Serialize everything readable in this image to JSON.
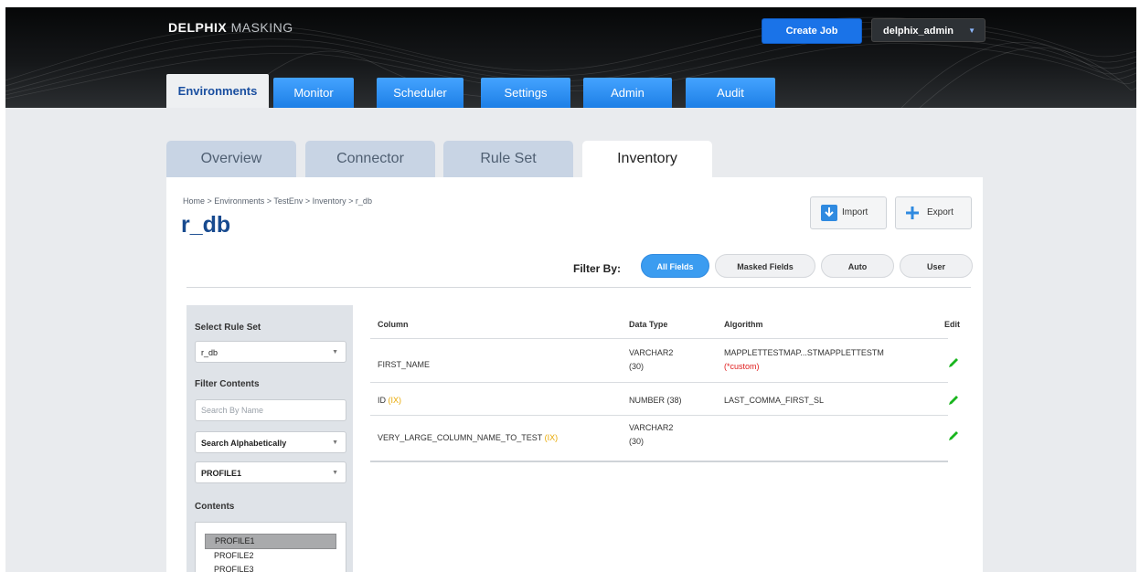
{
  "header": {
    "logo_bold": "DELPHIX",
    "logo_light": "MASKING",
    "create_job_label": "Create Job",
    "user_label": "delphix_admin"
  },
  "nav": {
    "tabs": [
      {
        "label": "Environments",
        "active": true
      },
      {
        "label": "Monitor"
      },
      {
        "label": "Scheduler"
      },
      {
        "label": "Settings"
      },
      {
        "label": "Admin"
      },
      {
        "label": "Audit"
      }
    ]
  },
  "content_tabs": [
    {
      "label": "Overview"
    },
    {
      "label": "Connector"
    },
    {
      "label": "Rule Set"
    },
    {
      "label": "Inventory",
      "active": true
    }
  ],
  "breadcrumb": "Home > Environments > TestEnv > Inventory > r_db",
  "page_title": "r_db",
  "actions": {
    "import_label": "Import",
    "export_label": "Export"
  },
  "filter": {
    "label": "Filter By:",
    "options": [
      {
        "label": "All Fields",
        "active": true
      },
      {
        "label": "Masked Fields"
      },
      {
        "label": "Auto"
      },
      {
        "label": "User"
      }
    ]
  },
  "sidebar": {
    "select_rule_set_label": "Select Rule Set",
    "rule_set_value": "r_db",
    "filter_contents_label": "Filter Contents",
    "search_placeholder": "Search By Name",
    "sort_value": "Search Alphabetically",
    "profile_value": "PROFILE1",
    "contents_label": "Contents",
    "contents": [
      "PROFILE1",
      "PROFILE2",
      "PROFILE3"
    ]
  },
  "table": {
    "headers": {
      "column": "Column",
      "data_type": "Data Type",
      "algorithm": "Algorithm",
      "edit": "Edit"
    },
    "rows": [
      {
        "column": "FIRST_NAME",
        "ix": "",
        "data_type_1": "VARCHAR2",
        "data_type_2": "(30)",
        "algorithm": "MAPPLETTESTMAP...STMAPPLETTESTM",
        "algorithm_note": "(*custom)"
      },
      {
        "column": "ID",
        "ix": "(IX)",
        "data_type_1": "NUMBER (38)",
        "data_type_2": "",
        "algorithm": "LAST_COMMA_FIRST_SL",
        "algorithm_note": ""
      },
      {
        "column": "VERY_LARGE_COLUMN_NAME_TO_TEST",
        "ix": "(IX)",
        "data_type_1": "VARCHAR2",
        "data_type_2": "(30)",
        "algorithm": "",
        "algorithm_note": ""
      }
    ]
  },
  "colors": {
    "accent_blue": "#1a73e8",
    "title_blue": "#174a8f",
    "ix_orange": "#e8a800",
    "custom_red": "#e02020",
    "edit_green": "#19b51e"
  },
  "icons": {
    "import": "import-icon",
    "export": "plus-icon",
    "edit": "pencil-icon",
    "dropdown": "chevron-down-icon"
  }
}
